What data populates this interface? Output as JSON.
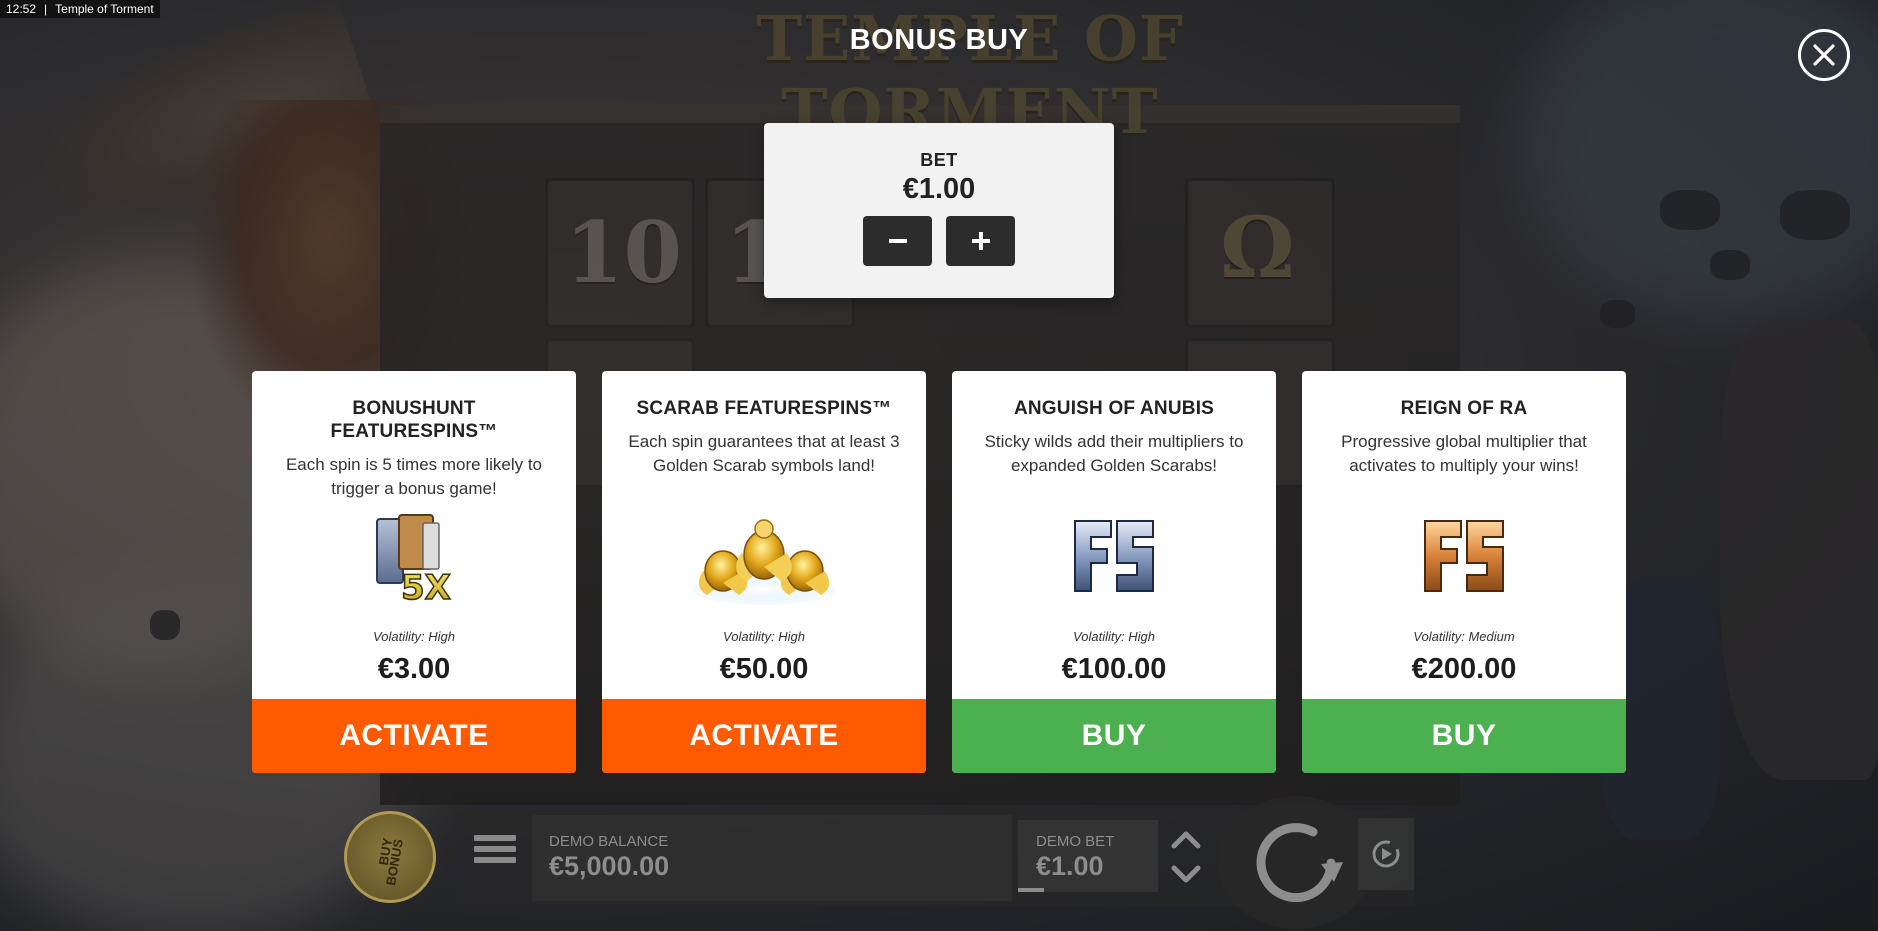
{
  "status_bar": {
    "time": "12:52",
    "separator": "|",
    "app_title": "Temple of Torment"
  },
  "background": {
    "game_logo": "TEMPLE OF TORMENT",
    "reel_symbols": [
      "10",
      "1",
      "Ω"
    ]
  },
  "modal": {
    "title": "BONUS BUY",
    "close_icon": "close-icon"
  },
  "bet": {
    "label": "BET",
    "value": "€1.00",
    "decrease_icon": "minus-icon",
    "increase_icon": "plus-icon"
  },
  "cards": [
    {
      "title": "BONUSHUNT FEATURESPINS™",
      "description": "Each spin is 5 times more likely to trigger a bonus game!",
      "icon": "fs-5x-icon",
      "volatility": "Volatility: High",
      "price": "€3.00",
      "action": "ACTIVATE",
      "action_color": "#ff5a00"
    },
    {
      "title": "SCARAB FEATURESPINS™",
      "description": "Each spin guarantees that at least 3 Golden Scarab symbols land!",
      "icon": "golden-scarabs-icon",
      "volatility": "Volatility: High",
      "price": "€50.00",
      "action": "ACTIVATE",
      "action_color": "#ff5a00"
    },
    {
      "title": "ANGUISH OF ANUBIS",
      "description": "Sticky wilds add their multipliers to expanded Golden Scarabs!",
      "icon": "fs-blue-icon",
      "volatility": "Volatility: High",
      "price": "€100.00",
      "action": "BUY",
      "action_color": "#4caf50"
    },
    {
      "title": "REIGN OF RA",
      "description": "Progressive global multiplier that activates to multiply your wins!",
      "icon": "fs-orange-icon",
      "volatility": "Volatility: Medium",
      "price": "€200.00",
      "action": "BUY",
      "action_color": "#4caf50"
    }
  ],
  "bottom_bar": {
    "buy_bonus_line1": "BUY",
    "buy_bonus_line2": "BONUS",
    "menu_icon": "hamburger-menu-icon",
    "balance_label": "DEMO BALANCE",
    "balance_value": "€5,000.00",
    "demo_bet_label": "DEMO BET",
    "demo_bet_value": "€1.00",
    "stepper_icon": "chevron-up-down-icon",
    "spin_icon": "spin-arrow-icon",
    "autoplay_icon": "autoplay-icon"
  }
}
